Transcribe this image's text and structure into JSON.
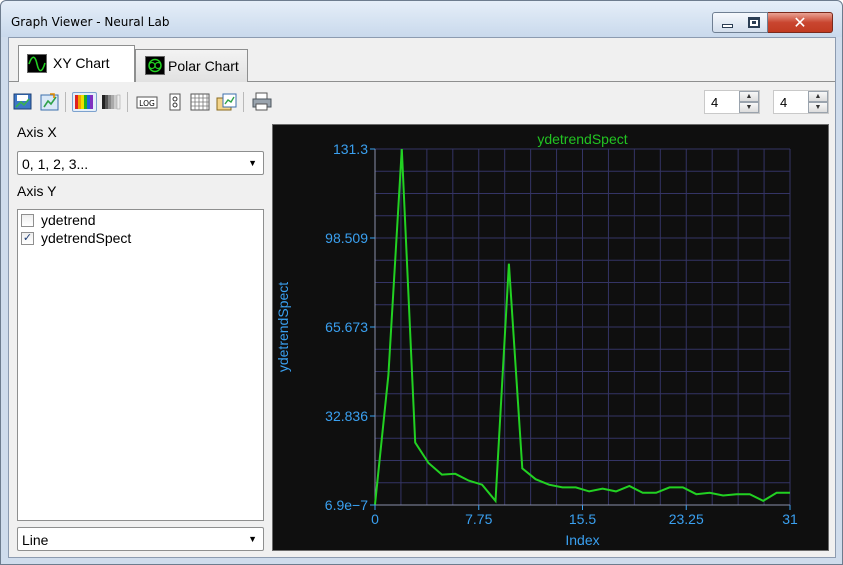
{
  "window": {
    "title": "Graph Viewer - Neural Lab",
    "close_glyph": "✕"
  },
  "tabs": [
    {
      "label": "XY Chart",
      "icon": "sine-wave-icon",
      "active": true
    },
    {
      "label": "Polar Chart",
      "icon": "polar-chart-icon",
      "active": false
    }
  ],
  "toolbar": {
    "buttons": [
      "save-chart-icon",
      "export-chart-icon",
      "color-palette-icon",
      "grayscale-palette-icon",
      "log-scale-icon",
      "format-icon",
      "grid-icon",
      "copy-icon",
      "print-icon"
    ],
    "log_label": "LOG"
  },
  "spinners": [
    {
      "value": "4"
    },
    {
      "value": "4"
    }
  ],
  "axis_x": {
    "label": "Axis X",
    "selected": "0, 1, 2, 3..."
  },
  "axis_y": {
    "label": "Axis Y",
    "items": [
      {
        "label": "ydetrend",
        "checked": false
      },
      {
        "label": "ydetrendSpect",
        "checked": true
      }
    ]
  },
  "chart_type": {
    "selected": "Line"
  },
  "colors": {
    "background": "#0f0f0f",
    "grid": "#343465",
    "axis_text": "#3aa0f0",
    "series": "#22d122",
    "title": "#22c422"
  },
  "chart_data": {
    "type": "line",
    "title": "ydetrendSpect",
    "xlabel": "Index",
    "ylabel": "ydetrendSpect",
    "xlim": [
      0,
      31
    ],
    "ylim": [
      6.9e-07,
      131.3
    ],
    "x_ticks": [
      "0",
      "7.75",
      "15.5",
      "23.25",
      "31"
    ],
    "y_ticks": [
      "6.9e−7",
      "32.836",
      "65.673",
      "98.509",
      "131.3"
    ],
    "series": [
      {
        "values": [
          0.2,
          48,
          131.3,
          23,
          15.5,
          11.2,
          11.5,
          9,
          7.5,
          1.5,
          89,
          13.5,
          9.5,
          7.5,
          6.5,
          6.5,
          5,
          6,
          5,
          7,
          4.5,
          4.5,
          6.5,
          6.5,
          4,
          4.5,
          3.5,
          4,
          4,
          1.5,
          4.5,
          4.5
        ]
      }
    ]
  }
}
